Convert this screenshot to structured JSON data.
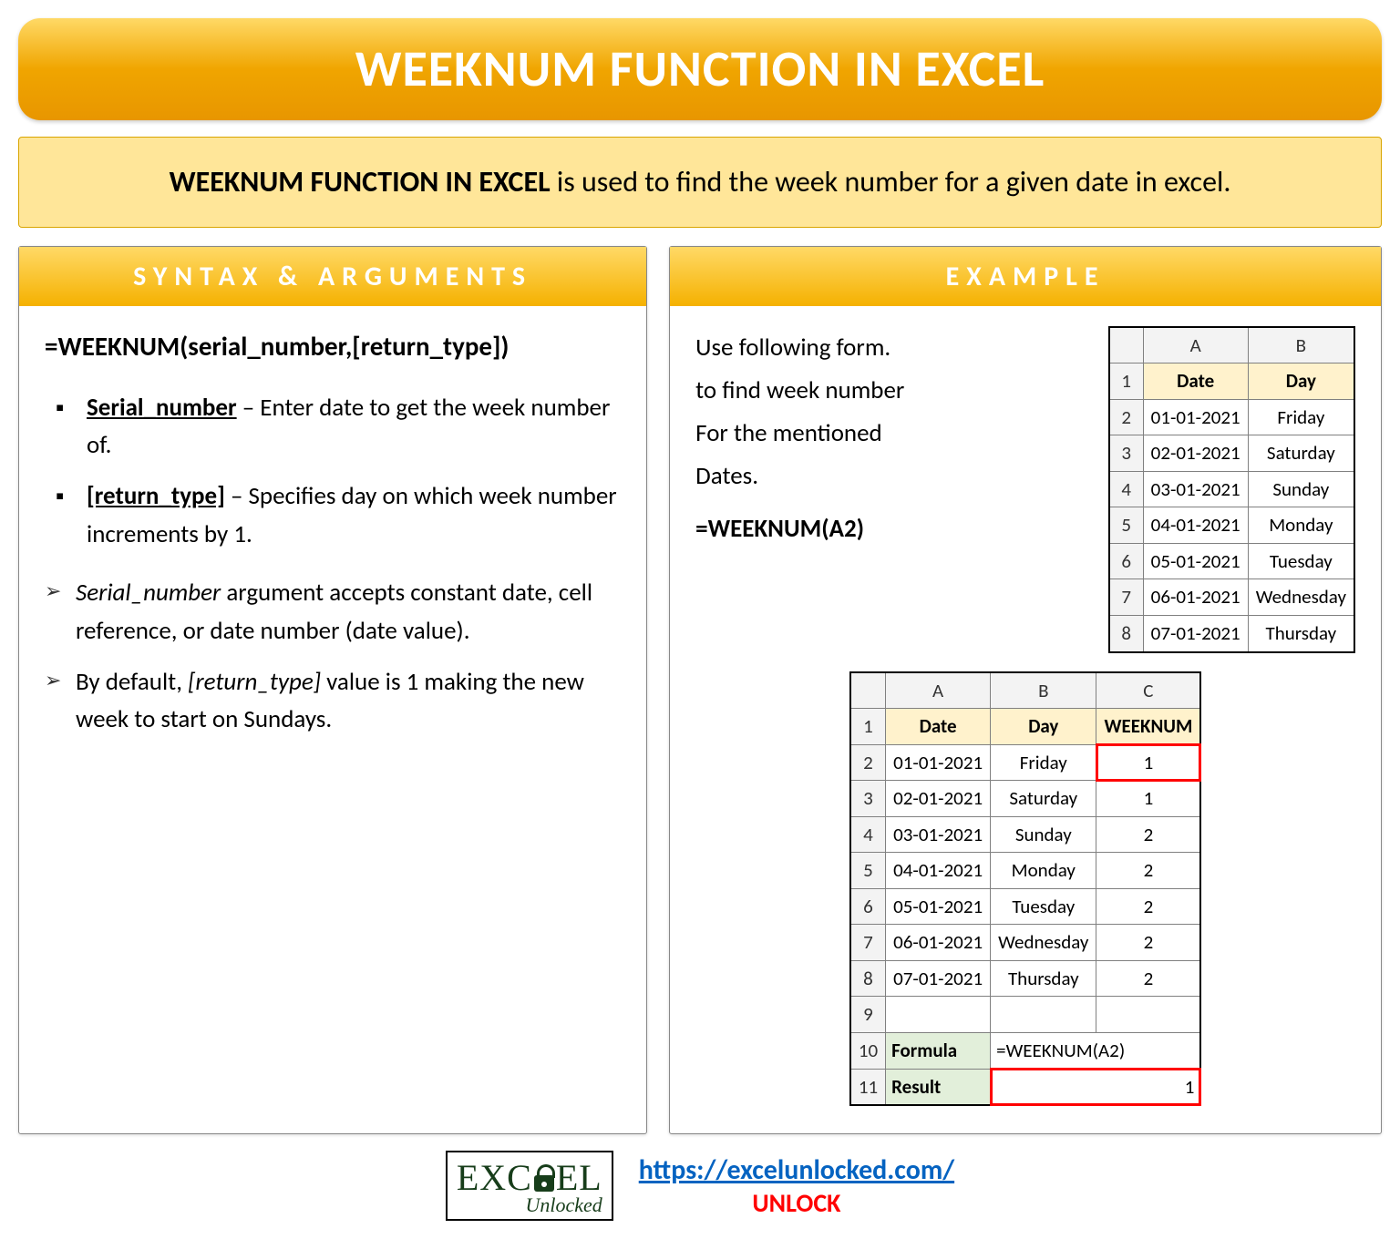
{
  "title": "WEEKNUM FUNCTION IN EXCEL",
  "intro": {
    "bold": "WEEKNUM FUNCTION IN EXCEL",
    "rest": " is used to find the week number for a given date in excel."
  },
  "syntax": {
    "header": "SYNTAX & ARGUMENTS",
    "formula": "=WEEKNUM(serial_number,[return_type])",
    "args": [
      {
        "name": "Serial_number",
        "desc": " – Enter date to get the week number of."
      },
      {
        "name": "[return_type]",
        "desc": " – Specifies day on which week number increments by 1."
      }
    ],
    "notes": [
      {
        "it1": "Serial_number",
        "rest": " argument accepts constant date, cell reference, or date number (date value)."
      },
      {
        "pre": "By default, ",
        "it1": "[return_type]",
        "rest": " value is 1 making the new week to start on Sundays."
      }
    ]
  },
  "example": {
    "header": "EXAMPLE",
    "text1": "Use following form.",
    "text2": "to find week number",
    "text3": "For the mentioned",
    "text4": "Dates.",
    "formula": "=WEEKNUM(A2)",
    "table1": {
      "cols": [
        "A",
        "B"
      ],
      "headers": [
        "Date",
        "Day"
      ],
      "rows": [
        [
          "01-01-2021",
          "Friday"
        ],
        [
          "02-01-2021",
          "Saturday"
        ],
        [
          "03-01-2021",
          "Sunday"
        ],
        [
          "04-01-2021",
          "Monday"
        ],
        [
          "05-01-2021",
          "Tuesday"
        ],
        [
          "06-01-2021",
          "Wednesday"
        ],
        [
          "07-01-2021",
          "Thursday"
        ]
      ]
    },
    "table2": {
      "cols": [
        "A",
        "B",
        "C"
      ],
      "headers": [
        "Date",
        "Day",
        "WEEKNUM"
      ],
      "rows": [
        [
          "01-01-2021",
          "Friday",
          "1"
        ],
        [
          "02-01-2021",
          "Saturday",
          "1"
        ],
        [
          "03-01-2021",
          "Sunday",
          "2"
        ],
        [
          "04-01-2021",
          "Monday",
          "2"
        ],
        [
          "05-01-2021",
          "Tuesday",
          "2"
        ],
        [
          "06-01-2021",
          "Wednesday",
          "2"
        ],
        [
          "07-01-2021",
          "Thursday",
          "2"
        ]
      ],
      "formula_label": "Formula",
      "formula_value": "=WEEKNUM(A2)",
      "result_label": "Result",
      "result_value": "1"
    }
  },
  "footer": {
    "logo_top": "EXC EL",
    "logo_sub": "Unlocked",
    "link": "https://excelunlocked.com/",
    "unlock": "UNLOCK"
  }
}
